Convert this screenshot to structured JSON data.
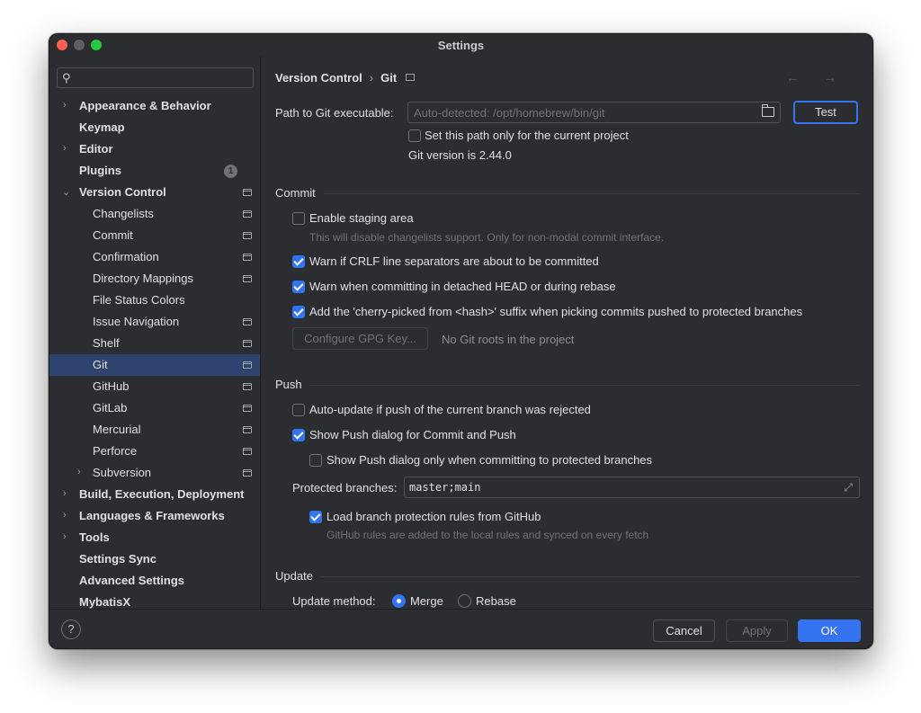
{
  "window": {
    "title": "Settings"
  },
  "search": {
    "placeholder": ""
  },
  "sidebar": {
    "items": [
      {
        "label": "Appearance & Behavior",
        "chevron": "›"
      },
      {
        "label": "Keymap"
      },
      {
        "label": "Editor",
        "chevron": "›"
      },
      {
        "label": "Plugins",
        "badge": "1"
      },
      {
        "label": "Version Control",
        "chevron": "⌄"
      },
      {
        "label": "Changelists"
      },
      {
        "label": "Commit"
      },
      {
        "label": "Confirmation"
      },
      {
        "label": "Directory Mappings"
      },
      {
        "label": "File Status Colors"
      },
      {
        "label": "Issue Navigation"
      },
      {
        "label": "Shelf"
      },
      {
        "label": "Git"
      },
      {
        "label": "GitHub"
      },
      {
        "label": "GitLab"
      },
      {
        "label": "Mercurial"
      },
      {
        "label": "Perforce"
      },
      {
        "label": "Subversion",
        "chevron": "›"
      },
      {
        "label": "Build, Execution, Deployment",
        "chevron": "›"
      },
      {
        "label": "Languages & Frameworks",
        "chevron": "›"
      },
      {
        "label": "Tools",
        "chevron": "›"
      },
      {
        "label": "Settings Sync"
      },
      {
        "label": "Advanced Settings"
      },
      {
        "label": "MybatisX"
      }
    ]
  },
  "breadcrumb": {
    "parent": "Version Control",
    "separator": "›",
    "current": "Git",
    "nav": "← →"
  },
  "git": {
    "path_label": "Path to Git executable:",
    "path_placeholder": "Auto-detected: /opt/homebrew/bin/git",
    "test_button": "Test",
    "project_only_label": "Set this path only for the current project",
    "version_text": "Git version is 2.44.0"
  },
  "commit": {
    "section_title": "Commit",
    "staging_label": "Enable staging area",
    "staging_hint": "This will disable changelists support. Only for non-modal commit interface.",
    "crlf_label": "Warn if CRLF line separators are about to be committed",
    "detached_label": "Warn when committing in detached HEAD or during rebase",
    "cherry_label": "Add the 'cherry-picked from <hash>' suffix when picking commits pushed to protected branches",
    "gpg_button": "Configure GPG Key...",
    "gpg_note": "No Git roots in the project"
  },
  "push": {
    "section_title": "Push",
    "autoupdate_label": "Auto-update if push of the current branch was rejected",
    "show_dialog_label": "Show Push dialog for Commit and Push",
    "protected_only_label": "Show Push dialog only when committing to protected branches",
    "protected_label": "Protected branches:",
    "protected_value": "master;main",
    "load_rules_label": "Load branch protection rules from GitHub",
    "load_rules_hint": "GitHub rules are added to the local rules and synced on every fetch"
  },
  "update": {
    "section_title": "Update",
    "method_label": "Update method:",
    "option_merge": "Merge",
    "option_rebase": "Rebase"
  },
  "footer": {
    "help": "?",
    "cancel": "Cancel",
    "apply": "Apply",
    "ok": "OK"
  },
  "colors": {
    "accent": "#3574f0",
    "background": "#2b2d30",
    "selection": "#2e436e"
  }
}
